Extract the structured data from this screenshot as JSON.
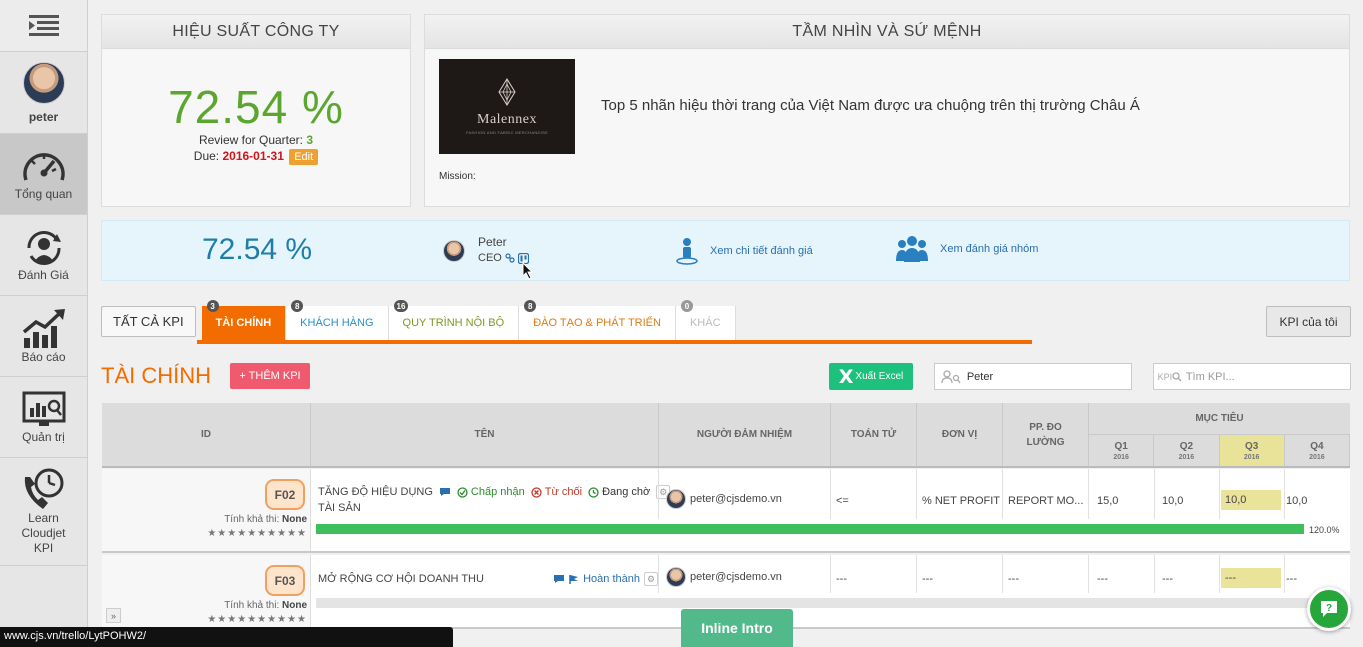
{
  "sidebar": {
    "user_name": "peter",
    "items": [
      {
        "label": "Tổng quan",
        "icon": "gauge-icon",
        "active": true
      },
      {
        "label": "Đánh Giá",
        "icon": "user-review-icon",
        "active": false
      },
      {
        "label": "Báo cáo",
        "icon": "chart-growth-icon",
        "active": false
      },
      {
        "label": "Quản trị",
        "icon": "monitor-search-icon",
        "active": false
      },
      {
        "label": "Learn\nCloudjet\nKPI",
        "icon": "phone-clock-icon",
        "active": false
      }
    ]
  },
  "performance": {
    "title": "HIỆU SUẤT CÔNG TY",
    "percent": "72.54 %",
    "review_label": "Review for Quarter: ",
    "quarter": "3",
    "due_label": "Due: ",
    "due_date": "2016-01-31",
    "edit_label": "Edit"
  },
  "vision": {
    "title": "TẦM NHÌN VÀ SỨ MỆNH",
    "logo_text": "Malennex",
    "logo_subtext": "FASHION AND FABRIC MERCHANDISE",
    "statement": "Top 5 nhãn hiệu thời trang của Việt Nam được ưa chuộng trên thị trường Châu Á",
    "mission_label": "Mission:"
  },
  "summary": {
    "percent": "72.54 %",
    "name": "Peter",
    "role": "CEO",
    "view_detail": "Xem chi tiết đánh giá",
    "view_group": "Xem đánh giá nhóm"
  },
  "tabs": {
    "all": "TẤT CẢ KPI",
    "items": [
      {
        "label": "TÀI CHÍNH",
        "count": "3",
        "color": "#ffffff",
        "active": true
      },
      {
        "label": "KHÁCH HÀNG",
        "count": "8",
        "color": "#2a8fc8",
        "active": false
      },
      {
        "label": "QUY TRÌNH NỘI BỘ",
        "count": "16",
        "color": "#7a9a24",
        "active": false
      },
      {
        "label": "ĐÀO TẠO & PHÁT TRIỂN",
        "count": "8",
        "color": "#e07a10",
        "active": false
      },
      {
        "label": "KHÁC",
        "count": "0",
        "color": "#bbbbbb",
        "active": false
      }
    ],
    "my_kpi": "KPI của tôi"
  },
  "section": {
    "title": "TÀI CHÍNH",
    "add_kpi": "+ THÊM KPI",
    "export_excel": "Xuất Excel",
    "person_search_value": "Peter",
    "kpi_search_prefix": "KPI",
    "kpi_search_placeholder": "Tìm KPI..."
  },
  "table": {
    "headers": {
      "id": "ID",
      "name": "TÊN",
      "owner": "NGƯỜI ĐẢM NHIỆM",
      "operator": "TOÁN TỬ",
      "unit": "ĐƠN VỊ",
      "method": "PP. ĐO LƯỜNG",
      "target": "MỤC TIÊU",
      "quarters": [
        {
          "q": "Q1",
          "year": "2016"
        },
        {
          "q": "Q2",
          "year": "2016"
        },
        {
          "q": "Q3",
          "year": "2016"
        },
        {
          "q": "Q4",
          "year": "2016"
        }
      ]
    },
    "rows": [
      {
        "code": "F02",
        "feasibility_label": "Tính khả thi: ",
        "feasibility": "None",
        "stars": "★★★★★★★★★★",
        "name_line1": "TĂNG ĐỘ HIỆU DỤNG",
        "name_line2": "TÀI SẢN",
        "status_accept": "Chấp nhận",
        "status_reject": "Từ chối",
        "status_pending": "Đang chờ",
        "owner": "peter@cjsdemo.vn",
        "operator": "<=",
        "unit": "% NET PROFIT",
        "method": "REPORT MO...",
        "q1": "15,0",
        "q2": "10,0",
        "q3": "10,0",
        "q4": "10,0",
        "progress": 1.0,
        "progress_label": "120.0%"
      },
      {
        "code": "F03",
        "feasibility_label": "Tính khả thi: ",
        "feasibility": "None",
        "stars": "★★★★★★★★★★",
        "name_line1": "MỞ RỘNG CƠ HỘI DOANH THU",
        "status_done": "Hoàn thành",
        "owner": "peter@cjsdemo.vn",
        "operator": "---",
        "unit": "---",
        "method": "---",
        "q1": "---",
        "q2": "---",
        "q3": "---",
        "q4": "---",
        "progress": 0
      }
    ]
  },
  "footer": {
    "status_url": "www.cjs.vn/trello/LytPOHW2/",
    "inline_intro": "Inline Intro",
    "chat": "?"
  },
  "colors": {
    "accent": "#f36c00",
    "success": "#5aa62e",
    "summary_blue": "#1d7fa8",
    "excel_green": "#1ec07e",
    "add_pink": "#ef5a6f"
  }
}
